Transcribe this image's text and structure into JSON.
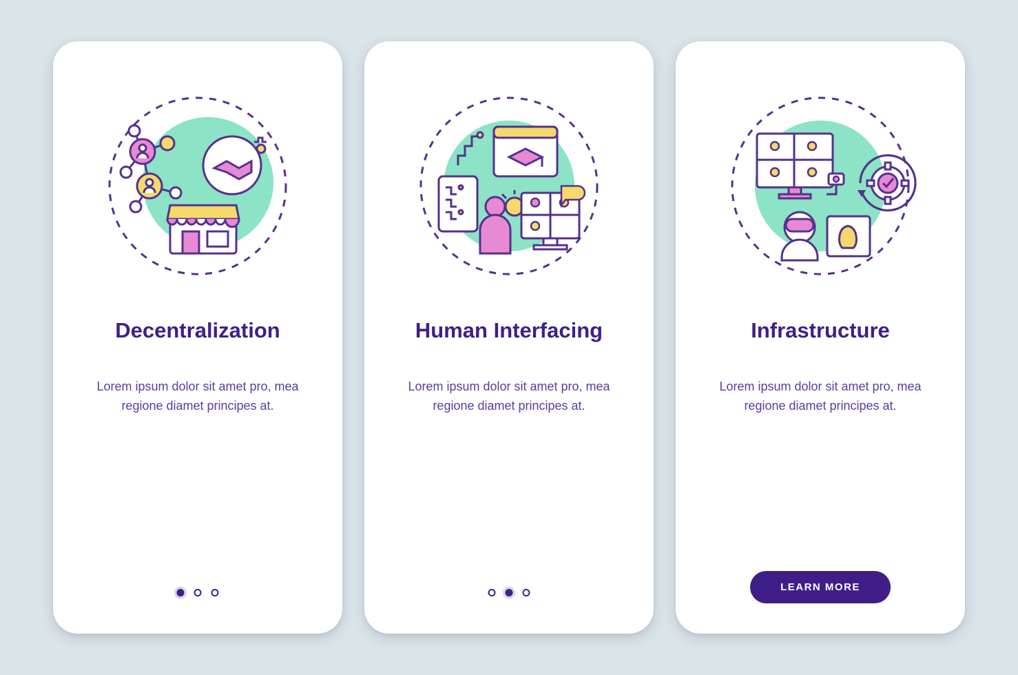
{
  "colors": {
    "accent_purple": "#3f1f87",
    "pink": "#e889d4",
    "yellow": "#f5d96b",
    "mint": "#8ce3c6",
    "stroke": "#54318d"
  },
  "common_body": "Lorem ipsum dolor sit amet pro, mea regione diamet principes at.",
  "cards": [
    {
      "title": "Decentralization",
      "body_ref": "common_body",
      "pager": {
        "count": 3,
        "active": 0
      },
      "has_cta": false,
      "illustration": "decentralization"
    },
    {
      "title": "Human Interfacing",
      "body_ref": "common_body",
      "pager": {
        "count": 3,
        "active": 1
      },
      "has_cta": false,
      "illustration": "human-interfacing"
    },
    {
      "title": "Infrastructure",
      "body_ref": "common_body",
      "pager": {
        "count": 3,
        "active": 2
      },
      "has_cta": true,
      "cta_label": "LEARN MORE",
      "illustration": "infrastructure"
    }
  ]
}
